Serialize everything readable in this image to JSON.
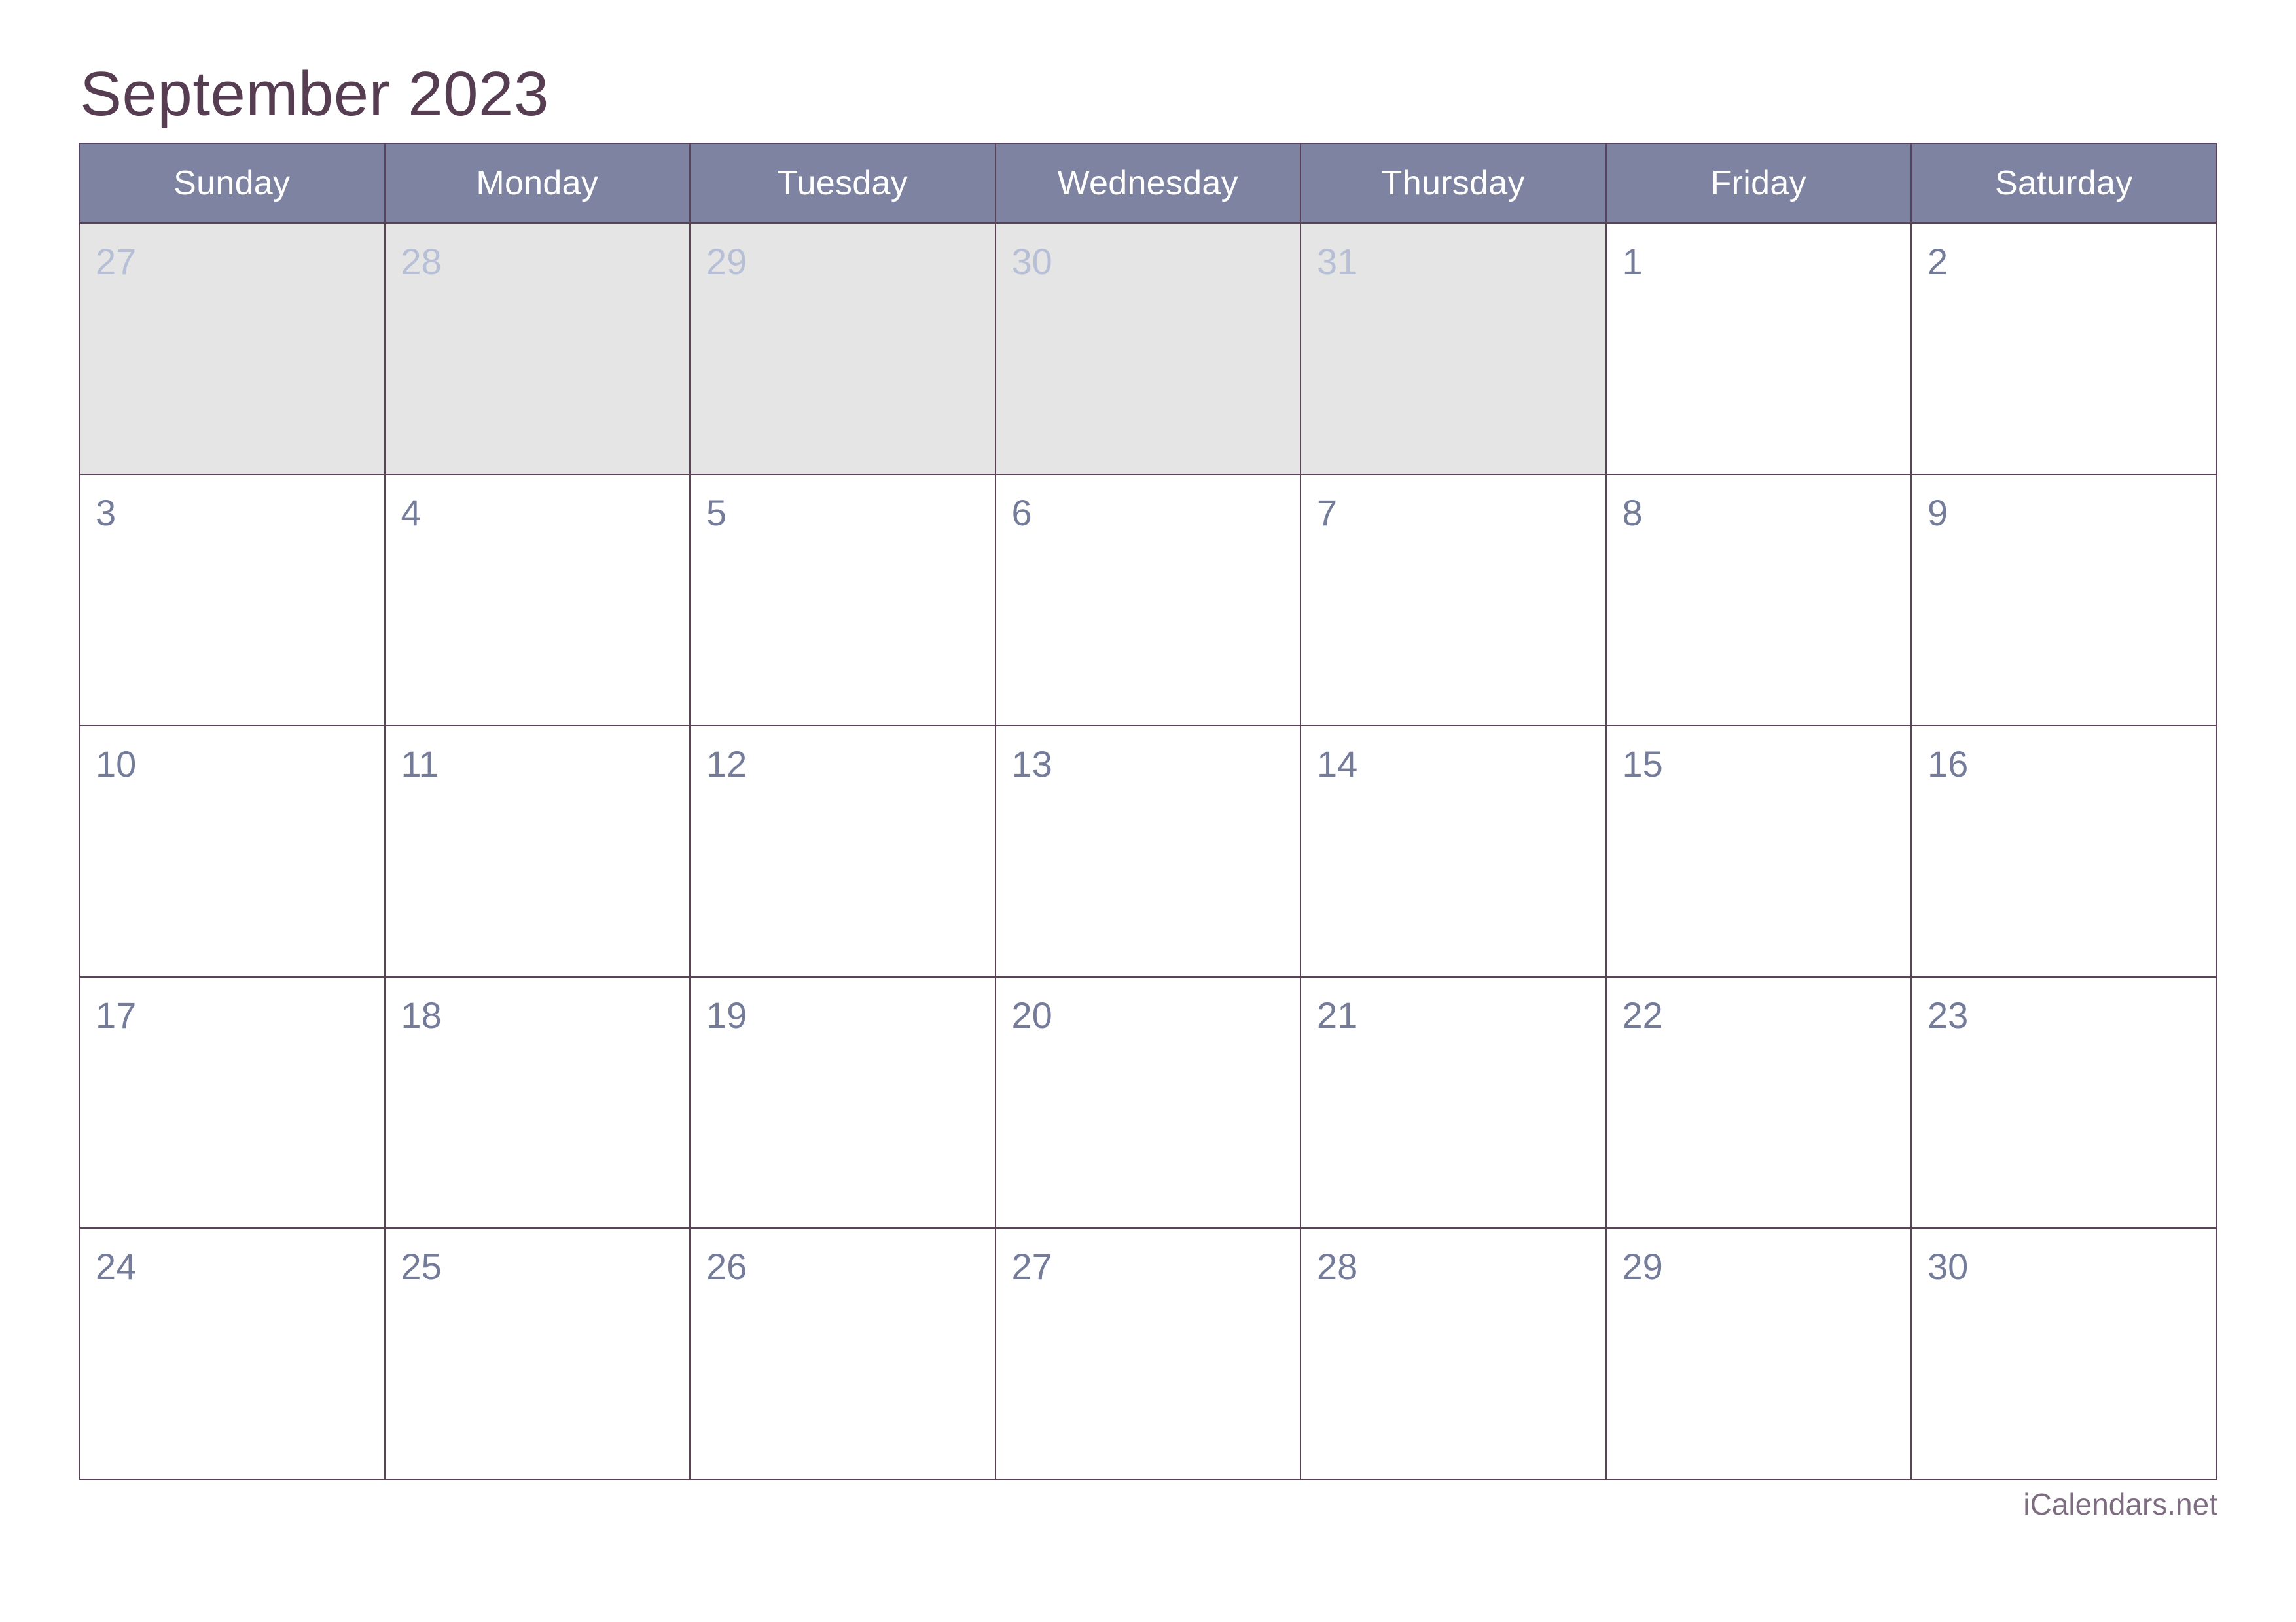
{
  "title": "September 2023",
  "month": "September",
  "year": "2023",
  "footer": "iCalendars.net",
  "colors": {
    "header_bg": "#7d83a0",
    "header_text": "#ffffff",
    "border": "#5c4258",
    "title_text": "#563d52",
    "daynum_current": "#747c9a",
    "daynum_other": "#b7bfd6",
    "other_month_bg": "#e5e5e5",
    "cell_bg": "#ffffff",
    "footer_text": "#7e6d80"
  },
  "weekdays": [
    "Sunday",
    "Monday",
    "Tuesday",
    "Wednesday",
    "Thursday",
    "Friday",
    "Saturday"
  ],
  "weeks": [
    [
      {
        "day": "27",
        "current_month": false
      },
      {
        "day": "28",
        "current_month": false
      },
      {
        "day": "29",
        "current_month": false
      },
      {
        "day": "30",
        "current_month": false
      },
      {
        "day": "31",
        "current_month": false
      },
      {
        "day": "1",
        "current_month": true
      },
      {
        "day": "2",
        "current_month": true
      }
    ],
    [
      {
        "day": "3",
        "current_month": true
      },
      {
        "day": "4",
        "current_month": true
      },
      {
        "day": "5",
        "current_month": true
      },
      {
        "day": "6",
        "current_month": true
      },
      {
        "day": "7",
        "current_month": true
      },
      {
        "day": "8",
        "current_month": true
      },
      {
        "day": "9",
        "current_month": true
      }
    ],
    [
      {
        "day": "10",
        "current_month": true
      },
      {
        "day": "11",
        "current_month": true
      },
      {
        "day": "12",
        "current_month": true
      },
      {
        "day": "13",
        "current_month": true
      },
      {
        "day": "14",
        "current_month": true
      },
      {
        "day": "15",
        "current_month": true
      },
      {
        "day": "16",
        "current_month": true
      }
    ],
    [
      {
        "day": "17",
        "current_month": true
      },
      {
        "day": "18",
        "current_month": true
      },
      {
        "day": "19",
        "current_month": true
      },
      {
        "day": "20",
        "current_month": true
      },
      {
        "day": "21",
        "current_month": true
      },
      {
        "day": "22",
        "current_month": true
      },
      {
        "day": "23",
        "current_month": true
      }
    ],
    [
      {
        "day": "24",
        "current_month": true
      },
      {
        "day": "25",
        "current_month": true
      },
      {
        "day": "26",
        "current_month": true
      },
      {
        "day": "27",
        "current_month": true
      },
      {
        "day": "28",
        "current_month": true
      },
      {
        "day": "29",
        "current_month": true
      },
      {
        "day": "30",
        "current_month": true
      }
    ]
  ]
}
